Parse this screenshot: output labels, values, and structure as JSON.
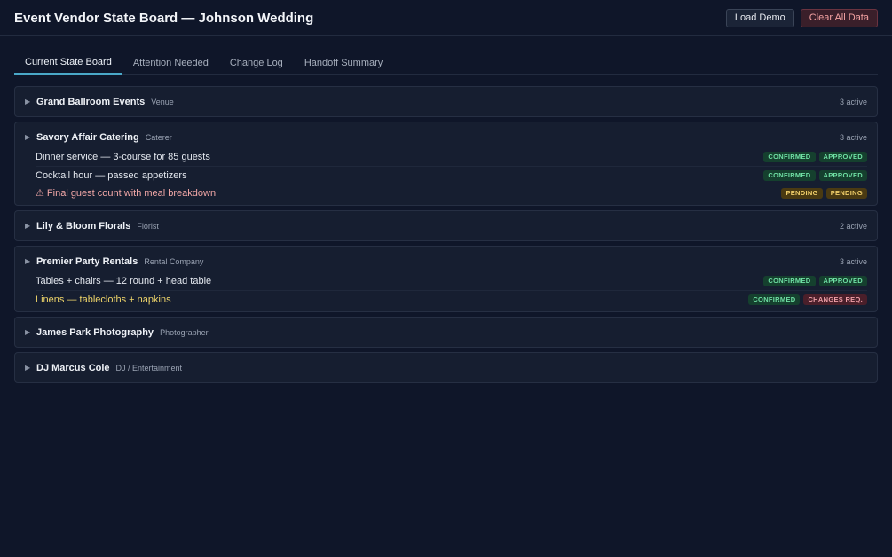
{
  "app": {
    "title": "Event Vendor State Board — Johnson Wedding",
    "load_demo_label": "Load Demo",
    "clear_label": "Clear All Data"
  },
  "tabs": [
    {
      "label": "Current State Board",
      "active": true
    },
    {
      "label": "Attention Needed",
      "active": false
    },
    {
      "label": "Change Log",
      "active": false
    },
    {
      "label": "Handoff Summary",
      "active": false
    }
  ],
  "vendors": [
    {
      "name": "Grand Ballroom Events",
      "type": "Venue",
      "count": "3 active",
      "expanded": false,
      "items": []
    },
    {
      "name": "Savory Affair Catering",
      "type": "Caterer",
      "count": "3 active",
      "expanded": true,
      "items": [
        {
          "text": "Dinner service — 3-course for 85 guests",
          "status": "CONFIRMED",
          "approval": "APPROVED"
        },
        {
          "text": "Cocktail hour — passed appetizers",
          "status": "CONFIRMED",
          "approval": "APPROVED"
        },
        {
          "text": "⚠ Final guest count with meal breakdown",
          "status": "PENDING",
          "approval": "PENDING",
          "warn": true
        }
      ]
    },
    {
      "name": "Lily & Bloom Florals",
      "type": "Florist",
      "count": "2 active",
      "expanded": false,
      "items": []
    },
    {
      "name": "Premier Party Rentals",
      "type": "Rental Company",
      "count": "3 active",
      "expanded": true,
      "items": [
        {
          "text": "Tables + chairs — 12 round + head table",
          "status": "CONFIRMED",
          "approval": "APPROVED"
        },
        {
          "text": "Linens — tablecloths + napkins",
          "status": "CONFIRMED",
          "approval": "CHANGES REQ.",
          "changes": true
        }
      ]
    },
    {
      "name": "James Park Photography",
      "type": "Photographer",
      "count": "",
      "expanded": false,
      "items": []
    },
    {
      "name": "DJ Marcus Cole",
      "type": "DJ / Entertainment",
      "count": "",
      "expanded": false,
      "items": []
    }
  ],
  "icons": {
    "caret": "caret-right-icon"
  },
  "colors": {
    "accent": "#4aa8c8",
    "confirmed": "#6fe0a4",
    "pending": "#f1cf6a",
    "changes": "#f0a0a8",
    "warning_text": "#f2a7a7"
  }
}
